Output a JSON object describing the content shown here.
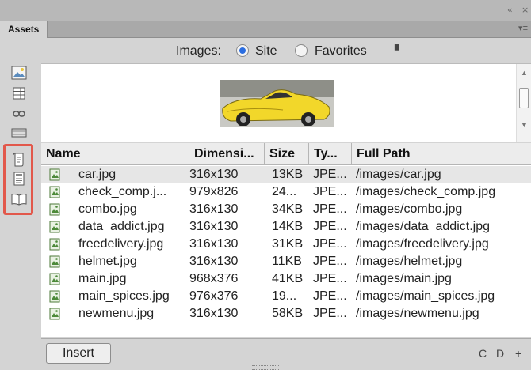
{
  "window": {
    "controls": [
      "«",
      "×"
    ]
  },
  "panel": {
    "tab_label": "Assets",
    "menu_icon": "panel-menu-icon"
  },
  "categories": [
    {
      "name": "images-icon"
    },
    {
      "name": "colors-icon"
    },
    {
      "name": "urls-icon"
    },
    {
      "name": "media-icon"
    },
    {
      "name": "scripts-icon"
    },
    {
      "name": "templates-icon"
    },
    {
      "name": "library-icon"
    }
  ],
  "filter": {
    "label": "Images:",
    "option_site": "Site",
    "option_favorites": "Favorites",
    "selected": "Site"
  },
  "table": {
    "headers": [
      "Name",
      "Dimensi...",
      "Size",
      "Ty...",
      "Full Path"
    ],
    "rows": [
      {
        "name": "car.jpg",
        "dim": "316x130",
        "size": "13KB",
        "type": "JPE...",
        "path": "/images/car.jpg",
        "selected": true
      },
      {
        "name": "check_comp.j...",
        "dim": "979x826",
        "size": "24...",
        "type": "JPE...",
        "path": "/images/check_comp.jpg"
      },
      {
        "name": "combo.jpg",
        "dim": "316x130",
        "size": "34KB",
        "type": "JPE...",
        "path": "/images/combo.jpg"
      },
      {
        "name": "data_addict.jpg",
        "dim": "316x130",
        "size": "14KB",
        "type": "JPE...",
        "path": "/images/data_addict.jpg"
      },
      {
        "name": "freedelivery.jpg",
        "dim": "316x130",
        "size": "31KB",
        "type": "JPE...",
        "path": "/images/freedelivery.jpg"
      },
      {
        "name": "helmet.jpg",
        "dim": "316x130",
        "size": "11KB",
        "type": "JPE...",
        "path": "/images/helmet.jpg"
      },
      {
        "name": "main.jpg",
        "dim": "968x376",
        "size": "41KB",
        "type": "JPE...",
        "path": "/images/main.jpg"
      },
      {
        "name": "main_spices.jpg",
        "dim": "976x376",
        "size": "19...",
        "type": "JPE...",
        "path": "/images/main_spices.jpg"
      },
      {
        "name": "newmenu.jpg",
        "dim": "316x130",
        "size": "58KB",
        "type": "JPE...",
        "path": "/images/newmenu.jpg"
      }
    ]
  },
  "bottom": {
    "insert_label": "Insert",
    "refresh_glyph": "C",
    "edit_glyph": "D",
    "add_glyph": "+"
  },
  "colors": {
    "highlight_border": "#e2584b",
    "radio_selected": "#2b6de0",
    "car_yellow": "#f2d72a"
  }
}
